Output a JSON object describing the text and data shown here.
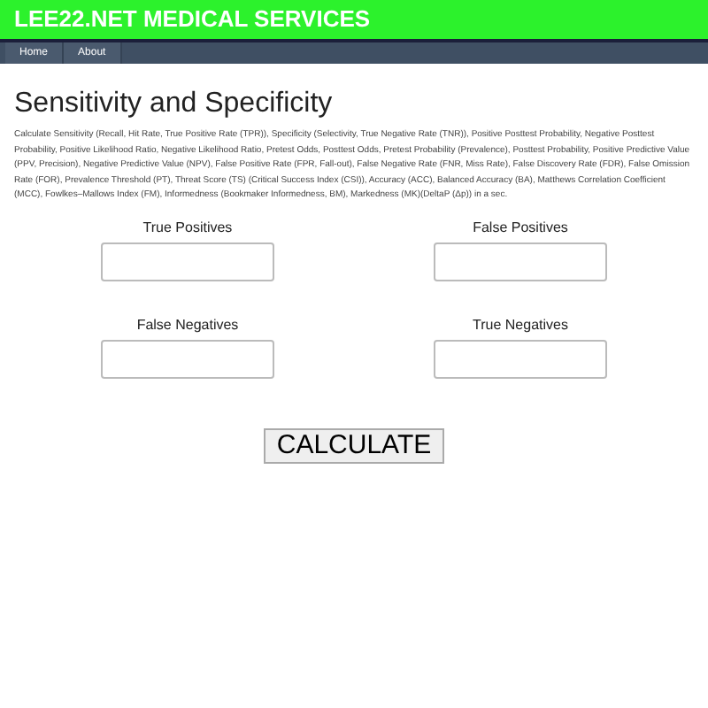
{
  "header": {
    "title": "LEE22.NET MEDICAL SERVICES"
  },
  "nav": [
    {
      "label": "Home"
    },
    {
      "label": "About"
    }
  ],
  "page_title": "Sensitivity and Specificity",
  "description": "Calculate Sensitivity (Recall, Hit Rate, True Positive Rate (TPR)), Specificity (Selectivity, True Negative Rate (TNR)), Positive Posttest Probability, Negative Posttest Probability, Positive Likelihood Ratio, Negative Likelihood Ratio, Pretest Odds, Posttest Odds, Pretest Probability (Prevalence), Posttest Probability, Positive Predictive Value (PPV, Precision), Negative Predictive Value (NPV), False Positive Rate (FPR, Fall-out), False Negative Rate (FNR, Miss Rate), False Discovery Rate (FDR), False Omission Rate (FOR), Prevalence Threshold (PT), Threat Score (TS) (Critical Success Index (CSI)), Accuracy (ACC), Balanced Accuracy (BA), Matthews Correlation Coefficient (MCC), Fowlkes–Mallows Index (FM), Informedness (Bookmaker Informedness, BM), Markedness (MK)(DeltaP (Δp)) in a sec.",
  "fields": [
    {
      "label": "True Positives"
    },
    {
      "label": "False Positives"
    },
    {
      "label": "False Negatives"
    },
    {
      "label": "True Negatives"
    }
  ],
  "button": "CALCULATE"
}
